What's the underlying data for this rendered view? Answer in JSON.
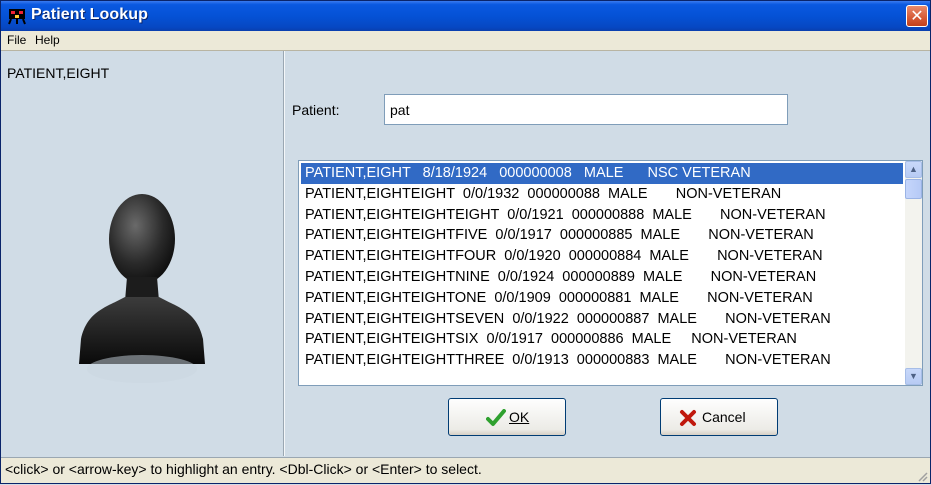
{
  "window": {
    "title": "Patient Lookup",
    "close_label": "✕"
  },
  "menu": {
    "file": "File",
    "help": "Help"
  },
  "left_panel": {
    "selected_name": "PATIENT,EIGHT"
  },
  "search": {
    "label": "Patient:",
    "value": "pat"
  },
  "results": [
    "PATIENT,EIGHT   8/18/1924   000000008   MALE      NSC VETERAN",
    "PATIENT,EIGHTEIGHT  0/0/1932  000000088  MALE       NON-VETERAN",
    "PATIENT,EIGHTEIGHTEIGHT  0/0/1921  000000888  MALE       NON-VETERAN",
    "PATIENT,EIGHTEIGHTFIVE  0/0/1917  000000885  MALE       NON-VETERAN",
    "PATIENT,EIGHTEIGHTFOUR  0/0/1920  000000884  MALE       NON-VETERAN",
    "PATIENT,EIGHTEIGHTNINE  0/0/1924  000000889  MALE       NON-VETERAN",
    "PATIENT,EIGHTEIGHTONE  0/0/1909  000000881  MALE       NON-VETERAN",
    "PATIENT,EIGHTEIGHTSEVEN  0/0/1922  000000887  MALE       NON-VETERAN",
    "PATIENT,EIGHTEIGHTSIX  0/0/1917  000000886  MALE     NON-VETERAN",
    "PATIENT,EIGHTEIGHTTHREE  0/0/1913  000000883  MALE       NON-VETERAN"
  ],
  "selected_index": 0,
  "buttons": {
    "ok_label": "OK",
    "cancel_label": "Cancel"
  },
  "status": {
    "text": "<click> or <arrow-key> to highlight an entry.  <Dbl-Click> or <Enter> to select."
  },
  "colors": {
    "titlebar": "#0552d6",
    "selection": "#316ac5",
    "panel": "#d0dce6"
  }
}
